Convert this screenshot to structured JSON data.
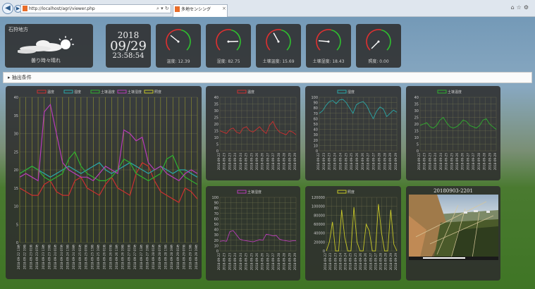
{
  "browser": {
    "url": "http://localhost/agri/viewer.php",
    "tab_title": "多地センシング",
    "back_icon": "back-arrow-icon",
    "forward_icon": "forward-arrow-icon"
  },
  "weather": {
    "region": "石狩地方",
    "forecast": "曇り時々晴れ",
    "icon": "cloudy-sunny-icon"
  },
  "datetime": {
    "year": "2018",
    "date": "09/29",
    "time": "23:58:54"
  },
  "gauges": [
    {
      "label": "温度: 12.39",
      "value": 12.39,
      "max": 40
    },
    {
      "label": "湿度: 82.75",
      "value": 82.75,
      "max": 100
    },
    {
      "label": "土壌温度: 15.69",
      "value": 15.69,
      "max": 40
    },
    {
      "label": "土壌湿度: 18.43",
      "value": 18.43,
      "max": 100
    },
    {
      "label": "照度: 0.00",
      "value": 0,
      "max": 120000
    }
  ],
  "filter": {
    "label": "抽出条件"
  },
  "colors": {
    "temp": "#cc3030",
    "humid": "#2aa8a8",
    "soil_temp": "#2fb02f",
    "soil_humid": "#b83cb8",
    "lux": "#c8c828"
  },
  "photo": {
    "caption": "20180903-2201"
  },
  "chart_data": [
    {
      "type": "line",
      "legend": [
        "温度",
        "湿度",
        "土壌温度",
        "土壌湿度",
        "照度"
      ],
      "ylim": [
        0,
        40
      ],
      "yticks": [
        "0",
        "5",
        "10",
        "15",
        "20",
        "25",
        "30",
        "35",
        "40"
      ],
      "xticks": [
        "2018-09-22 13時",
        "2018-09-22 19時",
        "2018-09-23 01時",
        "2018-09-23 07時",
        "2018-09-23 13時",
        "2018-09-23 19時",
        "2018-09-24 01時",
        "2018-09-24 07時",
        "2018-09-24 13時",
        "2018-09-24 19時",
        "2018-09-25 01時",
        "2018-09-25 07時",
        "2018-09-25 13時",
        "2018-09-25 19時",
        "2018-09-26 01時",
        "2018-09-26 07時",
        "2018-09-26 13時",
        "2018-09-26 19時",
        "2018-09-27 01時",
        "2018-09-27 07時",
        "2018-09-27 13時",
        "2018-09-27 19時",
        "2018-09-28 01時",
        "2018-09-28 07時",
        "2018-09-28 13時",
        "2018-09-28 19時",
        "2018-09-29 01時",
        "2018-09-29 07時",
        "2018-09-29 13時",
        "2018-09-29 19時"
      ],
      "series": [
        {
          "name": "温度",
          "color": "#cc3030",
          "values": [
            15,
            14,
            13,
            13,
            16,
            17,
            14,
            13,
            13,
            17,
            18,
            15,
            14,
            13,
            16,
            18,
            15,
            14,
            13,
            19,
            22,
            21,
            17,
            14,
            13,
            12,
            11,
            15,
            14,
            12
          ]
        },
        {
          "name": "湿度",
          "color": "#2aa8a8",
          "values": [
            19,
            20,
            21,
            20,
            19,
            18,
            19,
            20,
            21,
            20,
            19,
            20,
            21,
            22,
            20,
            19,
            20,
            21,
            22,
            21,
            20,
            19,
            20,
            21,
            20,
            19,
            20,
            20,
            19,
            18
          ]
        },
        {
          "name": "土壌温度",
          "color": "#2fb02f",
          "values": [
            19,
            20,
            21,
            20,
            18,
            17,
            18,
            19,
            23,
            25,
            21,
            19,
            18,
            17,
            17,
            18,
            20,
            23,
            22,
            19,
            18,
            17,
            18,
            19,
            23,
            24,
            20,
            18,
            17,
            16
          ]
        },
        {
          "name": "土壌湿度",
          "color": "#b83cb8",
          "values": [
            18,
            19,
            18,
            17,
            36,
            38,
            30,
            22,
            20,
            19,
            18,
            18,
            17,
            19,
            21,
            20,
            19,
            31,
            30,
            28,
            29,
            22,
            20,
            21,
            19,
            18,
            17,
            19,
            20,
            19
          ]
        }
      ]
    },
    {
      "type": "line",
      "legend": [
        "温度"
      ],
      "ylim": [
        0,
        40
      ],
      "yticks": [
        "0",
        "5",
        "10",
        "15",
        "20",
        "25",
        "30",
        "35",
        "40"
      ],
      "xticks": [
        "2018-09-22",
        "2018-09-23",
        "2018-09-23",
        "2018-09-24",
        "2018-09-24",
        "2018-09-25",
        "2018-09-25",
        "2018-09-26",
        "2018-09-26",
        "2018-09-27",
        "2018-09-27",
        "2018-09-28",
        "2018-09-28",
        "2018-09-29",
        "2018-09-29"
      ],
      "series": [
        {
          "name": "温度",
          "color": "#cc3030",
          "values": [
            15,
            14,
            13,
            16,
            17,
            14,
            13,
            17,
            18,
            15,
            14,
            16,
            18,
            15,
            13,
            19,
            22,
            17,
            14,
            13,
            12,
            15,
            14,
            12
          ]
        }
      ]
    },
    {
      "type": "line",
      "legend": [
        "湿度"
      ],
      "ylim": [
        0,
        100
      ],
      "yticks": [
        "0",
        "10",
        "20",
        "30",
        "40",
        "50",
        "60",
        "70",
        "80",
        "90",
        "100"
      ],
      "xticks": [
        "2018-09-22",
        "2018-09-23",
        "2018-09-23",
        "2018-09-24",
        "2018-09-24",
        "2018-09-25",
        "2018-09-25",
        "2018-09-26",
        "2018-09-26",
        "2018-09-27",
        "2018-09-27",
        "2018-09-28",
        "2018-09-28",
        "2018-09-29",
        "2018-09-29"
      ],
      "series": [
        {
          "name": "湿度",
          "color": "#2aa8a8",
          "values": [
            70,
            75,
            85,
            92,
            94,
            88,
            95,
            96,
            90,
            80,
            70,
            86,
            90,
            92,
            85,
            72,
            60,
            74,
            82,
            78,
            64,
            70,
            76,
            72
          ]
        }
      ]
    },
    {
      "type": "line",
      "legend": [
        "土壌温度"
      ],
      "ylim": [
        0,
        40
      ],
      "yticks": [
        "0",
        "5",
        "10",
        "15",
        "20",
        "25",
        "30",
        "35",
        "40"
      ],
      "xticks": [
        "2018-09-22",
        "2018-09-23",
        "2018-09-23",
        "2018-09-24",
        "2018-09-24",
        "2018-09-25",
        "2018-09-25",
        "2018-09-26",
        "2018-09-26",
        "2018-09-27",
        "2018-09-27",
        "2018-09-28",
        "2018-09-28",
        "2018-09-29",
        "2018-09-29"
      ],
      "series": [
        {
          "name": "土壌温度",
          "color": "#2fb02f",
          "values": [
            19,
            20,
            21,
            18,
            17,
            19,
            23,
            25,
            21,
            18,
            17,
            18,
            20,
            23,
            22,
            19,
            18,
            17,
            19,
            23,
            24,
            20,
            18,
            16
          ]
        }
      ]
    },
    {
      "type": "line",
      "legend": [
        "土壌湿度"
      ],
      "ylim": [
        0,
        100
      ],
      "yticks": [
        "0",
        "10",
        "20",
        "30",
        "40",
        "50",
        "60",
        "70",
        "80",
        "90",
        "100"
      ],
      "xticks": [
        "2018-09-22",
        "2018-09-23",
        "2018-09-23",
        "2018-09-24",
        "2018-09-24",
        "2018-09-25",
        "2018-09-25",
        "2018-09-26",
        "2018-09-26",
        "2018-09-27",
        "2018-09-27",
        "2018-09-28",
        "2018-09-28",
        "2018-09-29",
        "2018-09-29"
      ],
      "series": [
        {
          "name": "土壌湿度",
          "color": "#b83cb8",
          "values": [
            18,
            19,
            18,
            36,
            38,
            30,
            22,
            20,
            19,
            18,
            17,
            19,
            21,
            20,
            31,
            30,
            28,
            29,
            22,
            20,
            19,
            18,
            19,
            19
          ]
        }
      ]
    },
    {
      "type": "line",
      "legend": [
        "照度"
      ],
      "ylim": [
        0,
        120000
      ],
      "yticks": [
        "0",
        "20000",
        "40000",
        "60000",
        "80000",
        "100000",
        "120000"
      ],
      "xticks": [
        "2018-09-22",
        "2018-09-23",
        "2018-09-23",
        "2018-09-24",
        "2018-09-24",
        "2018-09-25",
        "2018-09-25",
        "2018-09-26",
        "2018-09-26",
        "2018-09-27",
        "2018-09-27",
        "2018-09-28",
        "2018-09-28",
        "2018-09-29",
        "2018-09-29"
      ],
      "series": [
        {
          "name": "照度",
          "color": "#c8c828",
          "values": [
            0,
            20000,
            65000,
            0,
            0,
            92000,
            30000,
            0,
            0,
            98000,
            20000,
            0,
            0,
            60000,
            45000,
            0,
            0,
            105000,
            40000,
            0,
            0,
            92000,
            15000,
            0
          ]
        }
      ]
    }
  ]
}
